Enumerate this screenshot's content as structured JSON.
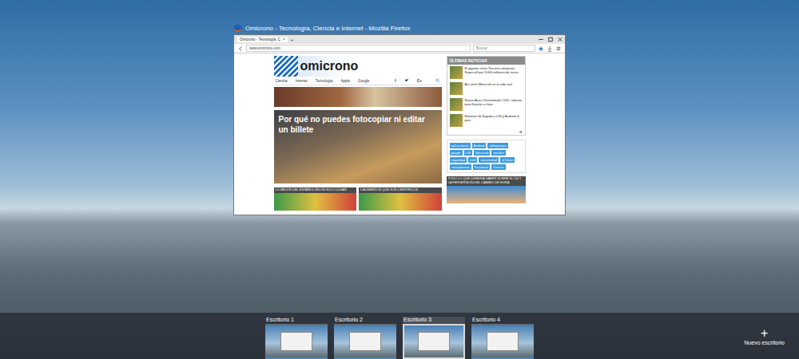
{
  "window": {
    "title": "Omicrono - Tecnología, Ciencia e Internet - Mozilla Firefox"
  },
  "browser": {
    "tab": {
      "label": "Omicrono - Tecnología, C",
      "close": "×"
    },
    "new_tab": "+",
    "url": "www.omicrono.com",
    "search_placeholder": "Buscar"
  },
  "site": {
    "logo": "omicrono",
    "nav": [
      "Ciencia",
      "Internet",
      "Tecnología",
      "Apple",
      "Google"
    ],
    "social": [
      {
        "kind": "glyph",
        "label": "f"
      },
      {
        "kind": "bird",
        "label": ""
      },
      {
        "kind": "glyph",
        "label": "G+"
      }
    ],
    "headline": "Por qué no puedes fotocopiar ni editar un billete",
    "latest": {
      "title": "ÚLTIMAS NOTICIAS",
      "items": [
        "El gigante chino Tencent compraría Supercell por 9.000 millones de euros",
        "Así sería Minecraft en la vida real",
        "Nuevo Asus Chromebook C202, robusto para llevarlo a clase",
        "Historias de llegada a iOS y Android al país"
      ],
      "more": "➜"
    },
    "tags": [
      "aplicaciones",
      "Android",
      "videojuegos",
      "google",
      "iOS",
      "Microsoft",
      "móviles",
      "seguridad",
      "intel",
      "universidad",
      "el futuro",
      "smartphones",
      "Facebook",
      "Ciencia"
    ],
    "cards": [
      "LO MEJOR DEL ESPAÑOL EN UN SOLO LUGAR",
      "5 ALIMENTOS QUE SON CIENTÍFICOS",
      "TODO LO QUE DEBERÍA SABER SOBRE EL 5G Y LA PERVERSIÓN DEL CAMBIO DE HORA"
    ]
  },
  "desktops": [
    {
      "label": "Escritorio 1",
      "selected": false
    },
    {
      "label": "Escritorio 2",
      "selected": false
    },
    {
      "label": "Escritorio 3",
      "selected": true
    },
    {
      "label": "Escritorio 4",
      "selected": false
    }
  ],
  "new_desktop": {
    "icon": "+",
    "label": "Nuevo escritorio"
  }
}
